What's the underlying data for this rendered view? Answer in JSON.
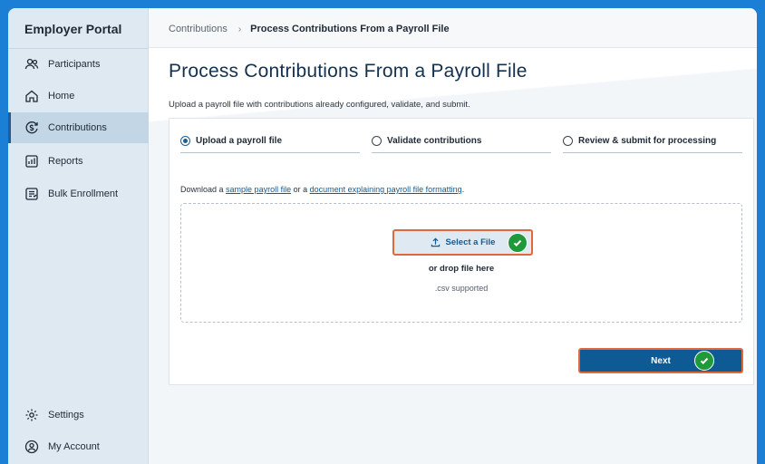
{
  "sidebar": {
    "brand": "Employer Portal",
    "items": [
      {
        "label": "Participants",
        "icon": "participants-icon"
      },
      {
        "label": "Home",
        "icon": "home-icon"
      },
      {
        "label": "Contributions",
        "icon": "contributions-icon",
        "active": true
      },
      {
        "label": "Reports",
        "icon": "reports-icon"
      },
      {
        "label": "Bulk Enrollment",
        "icon": "bulk-enrollment-icon"
      }
    ],
    "bottom_items": [
      {
        "label": "Settings",
        "icon": "gear-icon"
      },
      {
        "label": "My Account",
        "icon": "account-icon"
      }
    ]
  },
  "breadcrumb": {
    "parent": "Contributions",
    "separator": "›",
    "current": "Process Contributions From a Payroll File"
  },
  "page": {
    "title": "Process Contributions From a Payroll File",
    "subtitle": "Upload a payroll file with contributions already configured, validate, and submit."
  },
  "steps": [
    {
      "label": "Upload a payroll file",
      "state": "current"
    },
    {
      "label": "Validate contributions",
      "state": "pending"
    },
    {
      "label": "Review & submit for processing",
      "state": "pending"
    }
  ],
  "download": {
    "prefix": "Download a ",
    "sample_link": "sample payroll file",
    "middle": " or a ",
    "doc_link": "document explaining payroll file formatting",
    "suffix": "."
  },
  "dropzone": {
    "button_label": "Select a File",
    "drop_text": "or drop file here",
    "supported_text": ".csv supported"
  },
  "actions": {
    "next_label": "Next"
  },
  "colors": {
    "accent": "#0d5a94",
    "highlight_border": "#e0683f",
    "check_green": "#1f9a3b",
    "sidebar_bg": "#dfe9f1",
    "outer_bg": "#1c7fd6"
  }
}
